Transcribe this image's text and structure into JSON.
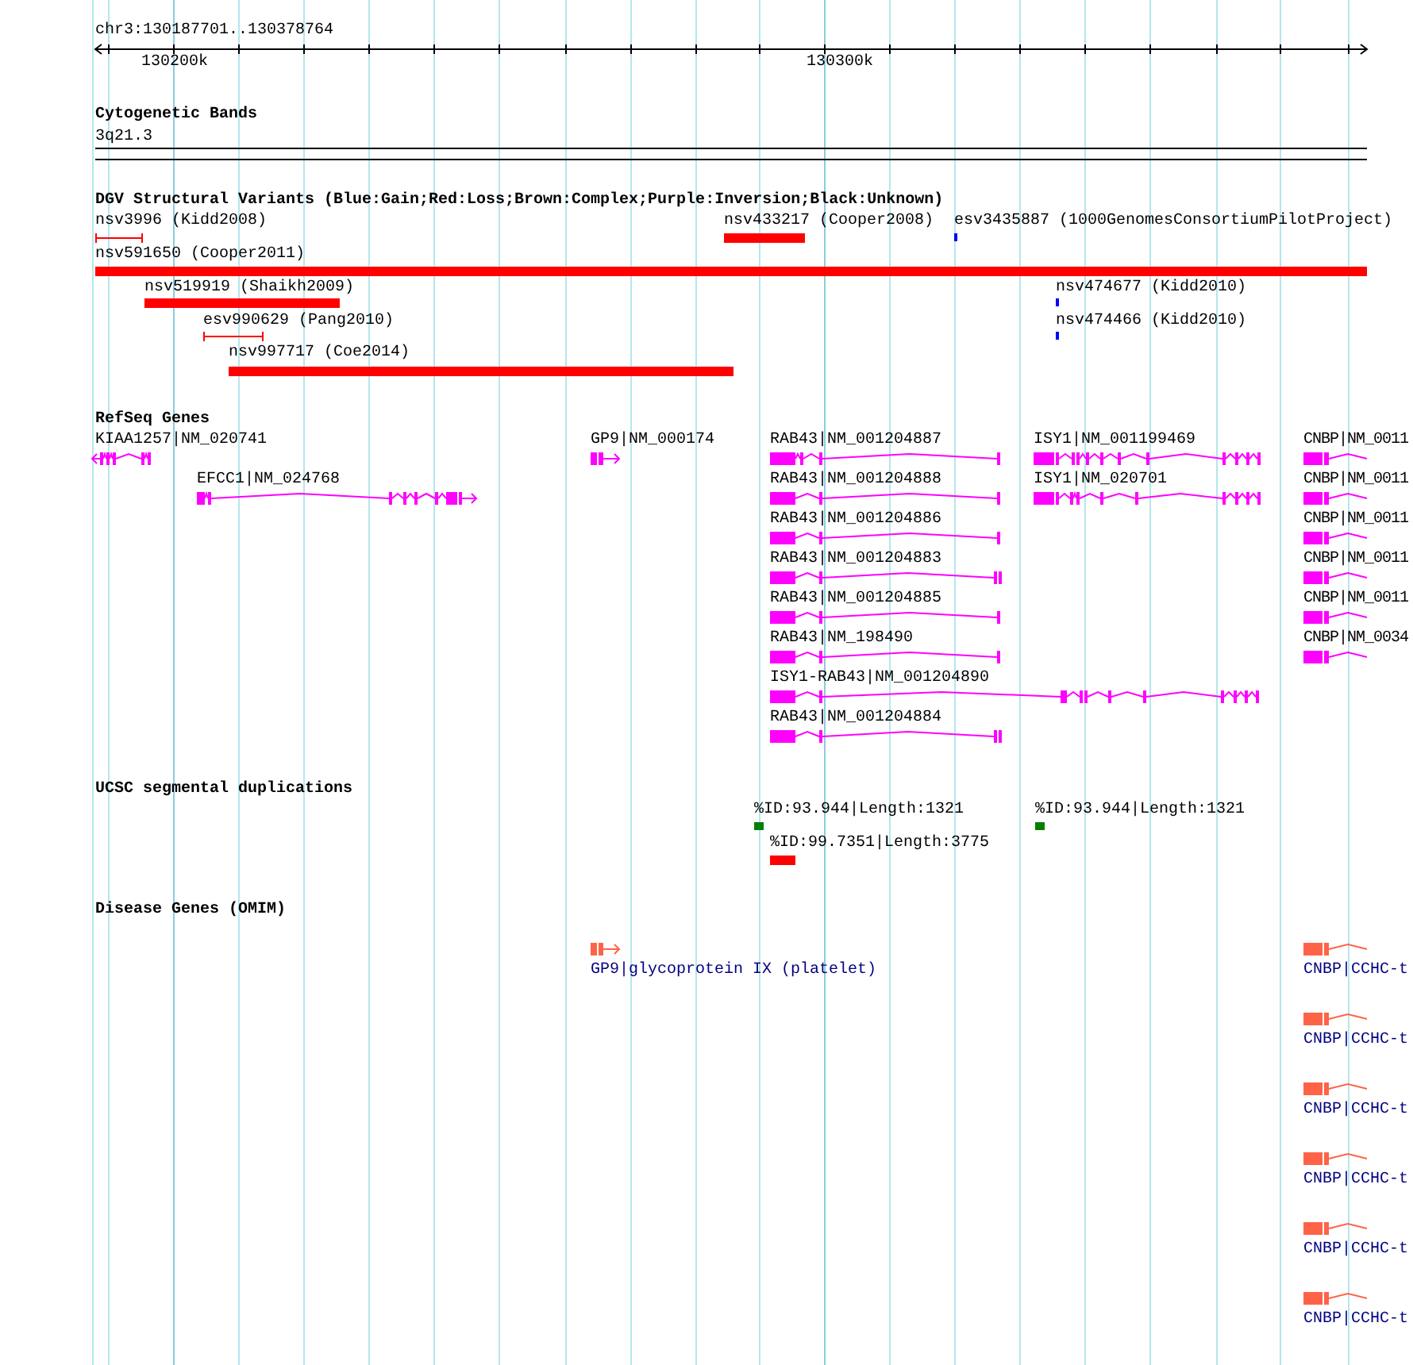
{
  "ruler": {
    "location": "chr3:130187701..130378764",
    "tick_labels": [
      "130200k",
      "130300k"
    ]
  },
  "cytogenetic_bands": {
    "title": "Cytogenetic Bands",
    "band": "3q21.3"
  },
  "dgv": {
    "title": "DGV Structural Variants (Blue:Gain;Red:Loss;Brown:Complex;Purple:Inversion;Black:Unknown)",
    "variants": [
      {
        "label": "nsv3996 (Kidd2008)",
        "color": "#ff0000"
      },
      {
        "label": "nsv433217 (Cooper2008)",
        "color": "#ff0000"
      },
      {
        "label": "esv3435887 (1000GenomesConsortiumPilotProject)",
        "color": "#0000ff"
      },
      {
        "label": "nsv591650 (Cooper2011)",
        "color": "#ff0000"
      },
      {
        "label": "nsv519919 (Shaikh2009)",
        "color": "#ff0000"
      },
      {
        "label": "nsv474677 (Kidd2010)",
        "color": "#0000ff"
      },
      {
        "label": "esv990629 (Pang2010)",
        "color": "#ff0000"
      },
      {
        "label": "nsv474466 (Kidd2010)",
        "color": "#0000ff"
      },
      {
        "label": "nsv997717 (Coe2014)",
        "color": "#ff0000"
      }
    ]
  },
  "refseq": {
    "title": "RefSeq Genes",
    "genes": [
      {
        "label": "KIAA1257|NM_020741"
      },
      {
        "label": "GP9|NM_000174"
      },
      {
        "label": "RAB43|NM_001204887"
      },
      {
        "label": "ISY1|NM_001199469"
      },
      {
        "label": "CNBP|NM_0011"
      },
      {
        "label": "EFCC1|NM_024768"
      },
      {
        "label": "RAB43|NM_001204888"
      },
      {
        "label": "ISY1|NM_020701"
      },
      {
        "label": "CNBP|NM_0011"
      },
      {
        "label": "RAB43|NM_001204886"
      },
      {
        "label": "CNBP|NM_0011"
      },
      {
        "label": "RAB43|NM_001204883"
      },
      {
        "label": "CNBP|NM_0011"
      },
      {
        "label": "RAB43|NM_001204885"
      },
      {
        "label": "CNBP|NM_0011"
      },
      {
        "label": "RAB43|NM_198490"
      },
      {
        "label": "CNBP|NM_0034"
      },
      {
        "label": "ISY1-RAB43|NM_001204890"
      },
      {
        "label": "RAB43|NM_001204884"
      }
    ]
  },
  "segmental_duplications": {
    "title": "UCSC segmental duplications",
    "features": [
      {
        "label": "%ID:93.944|Length:1321",
        "color": "#008000"
      },
      {
        "label": "%ID:93.944|Length:1321",
        "color": "#008000"
      },
      {
        "label": "%ID:99.7351|Length:3775",
        "color": "#ff0000"
      }
    ]
  },
  "disease_genes": {
    "title": "Disease Genes (OMIM)",
    "genes": [
      {
        "label": "GP9|glycoprotein IX (platelet)"
      },
      {
        "label": "CNBP|CCHC-t"
      },
      {
        "label": "CNBP|CCHC-t"
      },
      {
        "label": "CNBP|CCHC-t"
      },
      {
        "label": "CNBP|CCHC-t"
      },
      {
        "label": "CNBP|CCHC-t"
      },
      {
        "label": "CNBP|CCHC-t"
      }
    ]
  }
}
